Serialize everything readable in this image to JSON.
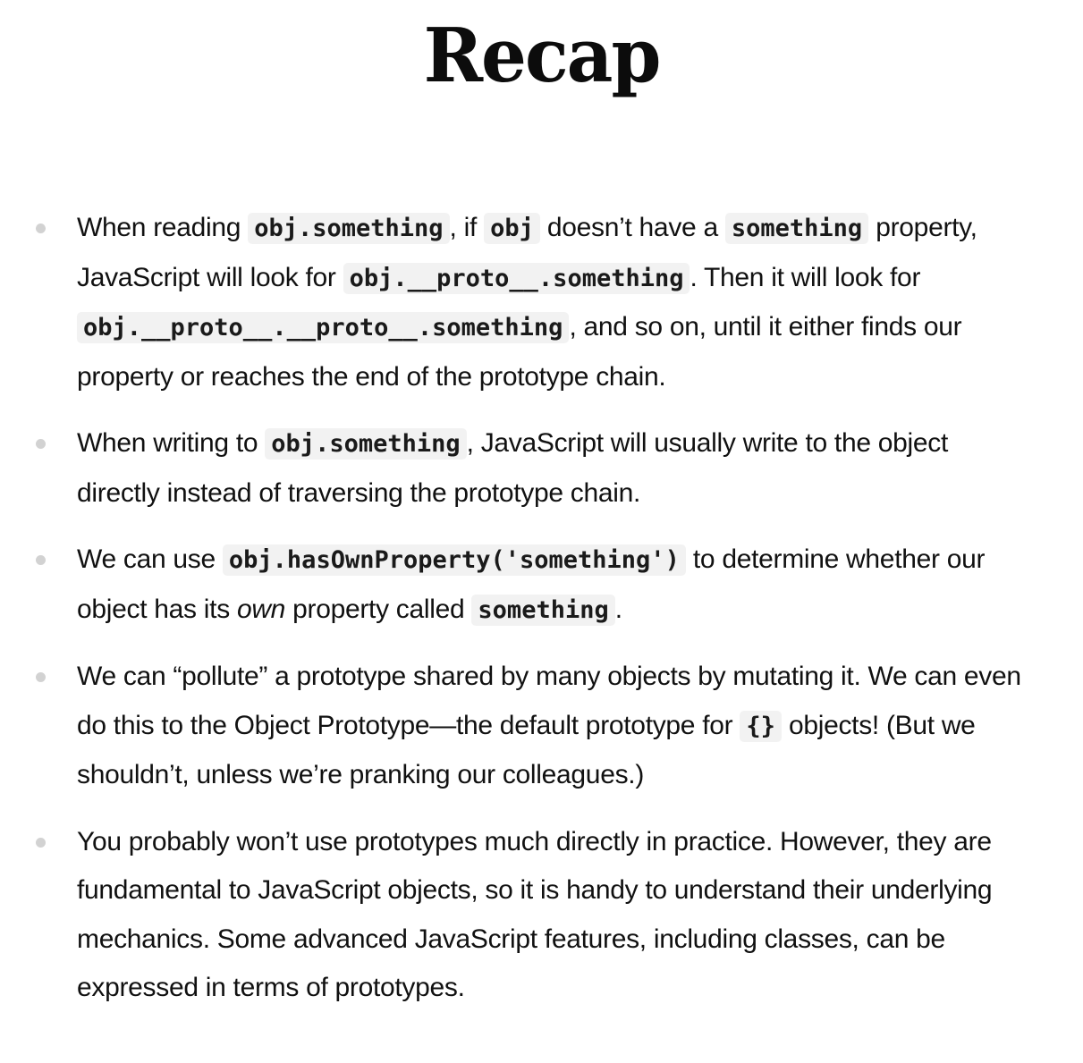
{
  "title": "Recap",
  "items": [
    {
      "p1": "When reading ",
      "c1": "obj.something",
      "p2": ", if ",
      "c2": "obj",
      "p3": " doesn’t have a ",
      "c3": "something",
      "p4": " property, JavaScript will look for ",
      "c4": "obj.__proto__.something",
      "p5": ". Then it will look for ",
      "c5": "obj.__proto__.__proto__.something",
      "p6": ", and so on, until it either finds our property or reaches the end of the prototype chain."
    },
    {
      "p1": "When writing to ",
      "c1": "obj.something",
      "p2": ", JavaScript will usually write to the object directly instead of traversing the prototype chain."
    },
    {
      "p1": "We can use ",
      "c1": "obj.hasOwnProperty('something')",
      "p2": " to determine whether our object has its ",
      "em": "own",
      "p3": " property called ",
      "c2": "something",
      "p4": "."
    },
    {
      "p1": "We can “pollute” a prototype shared by many objects by mutating it. We can even do this to the Object Prototype—the default prototype for ",
      "c1": "{}",
      "p2": " objects! (But we shouldn’t, unless we’re pranking our colleagues.)"
    },
    {
      "p1": "You probably won’t use prototypes much directly in practice. However, they are fundamental to JavaScript objects, so it is handy to understand their underlying mechanics. Some advanced JavaScript features, including classes, can be expressed in terms of prototypes."
    }
  ]
}
